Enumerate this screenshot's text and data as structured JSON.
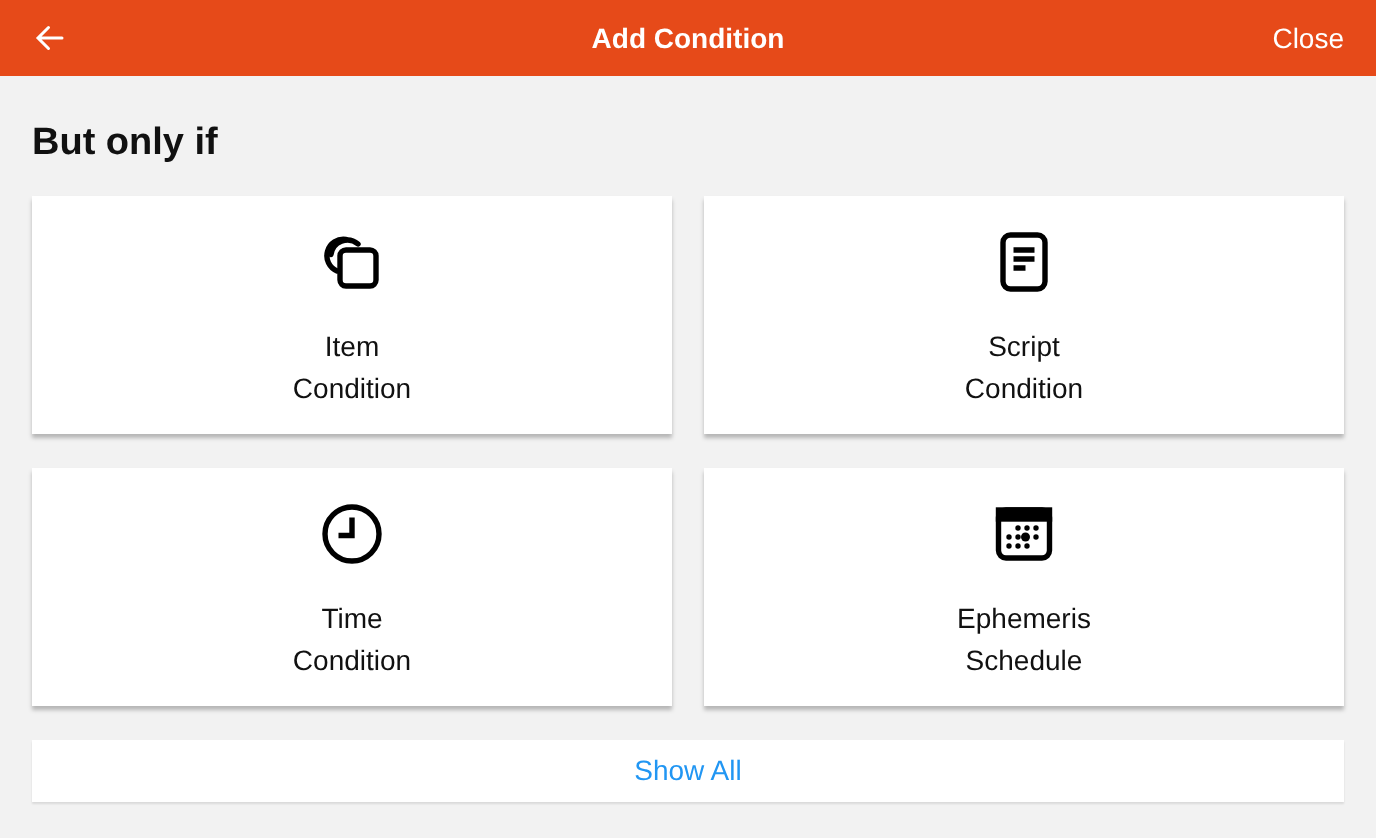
{
  "header": {
    "title": "Add Condition",
    "close": "Close"
  },
  "section_title": "But only if",
  "cards": [
    {
      "kind": "item",
      "lines": [
        "Item",
        "Condition"
      ]
    },
    {
      "kind": "script",
      "lines": [
        "Script",
        "Condition"
      ]
    },
    {
      "kind": "time",
      "lines": [
        "Time",
        "Condition"
      ]
    },
    {
      "kind": "ephemeris",
      "lines": [
        "Ephemeris",
        "Schedule"
      ]
    }
  ],
  "show_all": "Show All"
}
